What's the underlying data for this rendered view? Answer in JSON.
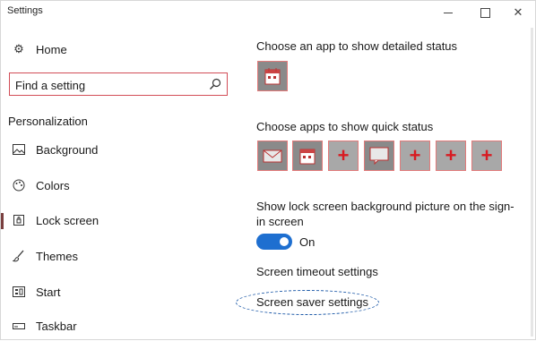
{
  "window": {
    "title": "Settings"
  },
  "sidebar": {
    "home": {
      "label": "Home"
    },
    "search": {
      "placeholder": "Find a setting"
    },
    "section": "Personalization",
    "items": [
      {
        "label": "Background",
        "icon": "picture-icon"
      },
      {
        "label": "Colors",
        "icon": "palette-icon"
      },
      {
        "label": "Lock screen",
        "icon": "lock-screen-icon",
        "active": true
      },
      {
        "label": "Themes",
        "icon": "brush-icon"
      },
      {
        "label": "Start",
        "icon": "start-icon"
      },
      {
        "label": "Taskbar",
        "icon": "taskbar-icon"
      }
    ]
  },
  "main": {
    "detailed_status_label": "Choose an app to show detailed status",
    "quick_status_label": "Choose apps to show quick status",
    "signin_picture_label": "Show lock screen background picture on the sign-in screen",
    "toggle": {
      "state_label": "On",
      "value": true
    },
    "timeout_link": "Screen timeout settings",
    "screensaver_link": "Screen saver settings"
  },
  "colors": {
    "accent": "#1e6fd0",
    "highlight": "#d24d57"
  }
}
